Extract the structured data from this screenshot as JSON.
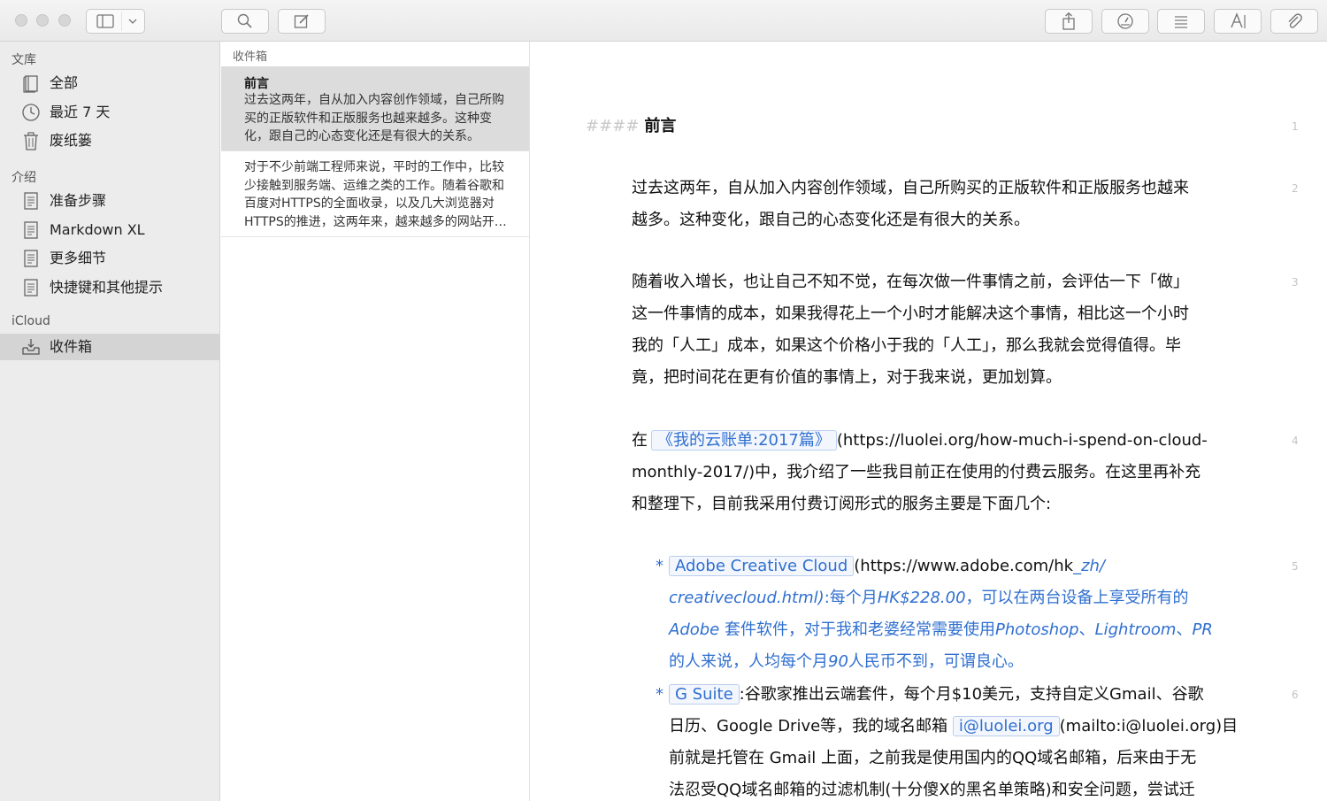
{
  "sidebar": {
    "library_header": "文库",
    "library_items": [
      {
        "label": "全部",
        "icon": "notebook-icon"
      },
      {
        "label": "最近 7 天",
        "icon": "clock-icon"
      },
      {
        "label": "废纸篓",
        "icon": "trash-icon"
      }
    ],
    "intro_header": "介绍",
    "intro_items": [
      {
        "label": "准备步骤",
        "icon": "document-icon"
      },
      {
        "label": "Markdown XL",
        "icon": "document-icon"
      },
      {
        "label": "更多细节",
        "icon": "document-icon"
      },
      {
        "label": "快捷键和其他提示",
        "icon": "document-icon"
      }
    ],
    "icloud_header": "iCloud",
    "icloud_items": [
      {
        "label": "收件箱",
        "icon": "inbox-icon",
        "selected": true
      }
    ]
  },
  "note_list": {
    "header": "收件箱",
    "notes": [
      {
        "title": "前言",
        "excerpt": "过去这两年，自从加入内容创作领域，自己所购买的正版软件和正版服务也越来越多。这种变化，跟自己的心态变化还是有很大的关系。",
        "selected": true
      },
      {
        "title": "",
        "excerpt": "对于不少前端工程师来说，平时的工作中，比较少接触到服务端、运维之类的工作。随着谷歌和百度对HTTPS的全面收录，以及几大浏览器对HTTPS的推进，这两年来，越来越多的网站开始使用HTTPS。",
        "selected": false
      }
    ]
  },
  "editor": {
    "heading_mark": "####",
    "heading": "前言",
    "line_numbers": [
      "1",
      "2",
      "3",
      "4",
      "5",
      "6"
    ],
    "p2": [
      "过去这两年，自从加入内容创作领域，自己所购买的正版软件和正版服务也越来",
      "越多。这种变化，跟自己的心态变化还是有很大的关系。"
    ],
    "p3": [
      "随着收入增长，也让自己不知不觉，在每次做一件事情之前，会评估一下「做」",
      "这一件事情的成本，如果我得花上一个小时才能解决这个事情，相比这一个小时",
      "我的「人工」成本，如果这个价格小于我的「人工」，那么我就会觉得值得。毕",
      "竟，把时间花在更有价值的事情上，对于我来说，更加划算。"
    ],
    "p4": {
      "prefix": "在",
      "link": "《我的云账单:2017篇》",
      "url_part1": "(https://luolei.org/how-much-i-spend-on-cloud-",
      "line2": "monthly-2017/)中，我介绍了一些我目前正在使用的付费云服务。在这里再补充",
      "line3": "和整理下，目前我采用付费订阅形式的服务主要是下面几个:"
    },
    "bullet_mark": "*",
    "b5": {
      "link": "Adobe Creative Cloud",
      "url_a": "(https://www.adobe.com/hk",
      "url_b": "_zh/",
      "line2_a": "creativecloud.html)",
      "line2_b": ":每个月",
      "line2_c": "HK$228.00",
      "line2_d": "，可以在两台设备上享受所有的",
      "line3_a": "Adobe",
      "line3_b": " 套件软件，对于我和老婆经常需要使用",
      "line3_c": "Photoshop",
      "line3_d": "、",
      "line3_e": "Lightroom",
      "line3_f": "、",
      "line3_g": "PR",
      "line4_a": "的人来说，人均每个月",
      "line4_b": "90",
      "line4_c": "人民币不到，可谓良心。"
    },
    "b6": {
      "link": "G Suite",
      "text1": ":谷歌家推出云端套件，每个月$10美元，支持自定义Gmail、谷歌",
      "line2_a": "日历、Google Drive等，我的域名邮箱 ",
      "line2_link": "i@luolei.org",
      "line2_b": "(mailto:i@luolei.org)目",
      "line3": "前就是托管在 Gmail 上面，之前我是使用国内的QQ域名邮箱，后来由于无",
      "line4": "法忍受QQ域名邮箱的过滤机制(十分傻X的黑名单策略)和安全问题，尝试迁"
    }
  }
}
